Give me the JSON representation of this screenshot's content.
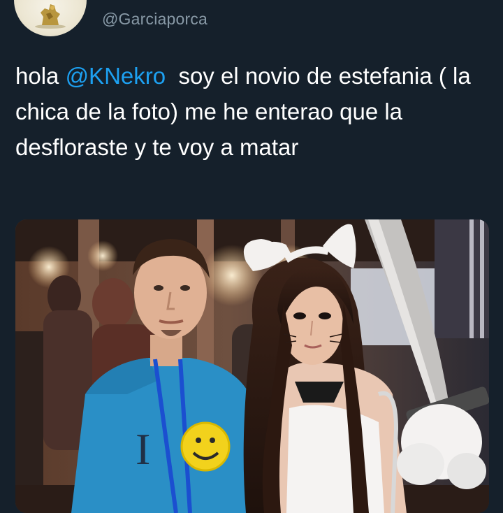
{
  "colors": {
    "background": "#15202b",
    "text": "#ffffff",
    "muted": "#8899a6",
    "accent": "#1da1f2"
  },
  "tweet": {
    "handle": "@Garciaporca",
    "text_before": "hola ",
    "mention": "@KNekro",
    "text_after": "  soy el novio de estefania ( la chica de la foto) me he enterao que la desfloraste y te voy a matar",
    "media": {
      "shirt_print_letter": "I"
    }
  }
}
